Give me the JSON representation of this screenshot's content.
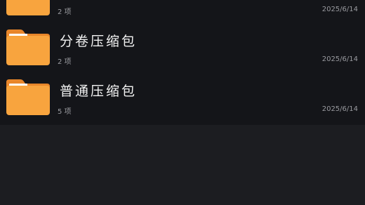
{
  "file_list": {
    "items": [
      {
        "name": "",
        "count": "2 项",
        "date": "2025/6/14",
        "icon": "folder-icon"
      },
      {
        "name": "分卷压缩包",
        "count": "2 项",
        "date": "2025/6/14",
        "icon": "folder-icon"
      },
      {
        "name": "普通压缩包",
        "count": "5 项",
        "date": "2025/6/14",
        "icon": "folder-icon"
      }
    ]
  },
  "colors": {
    "background": "#1c1d21",
    "list_background": "#141519",
    "folder_body": "#f8a43e",
    "folder_tab": "#e8862a",
    "folder_paper": "#ffffff",
    "primary_text": "#f2f2f2",
    "secondary_text": "#9a9ba0"
  }
}
